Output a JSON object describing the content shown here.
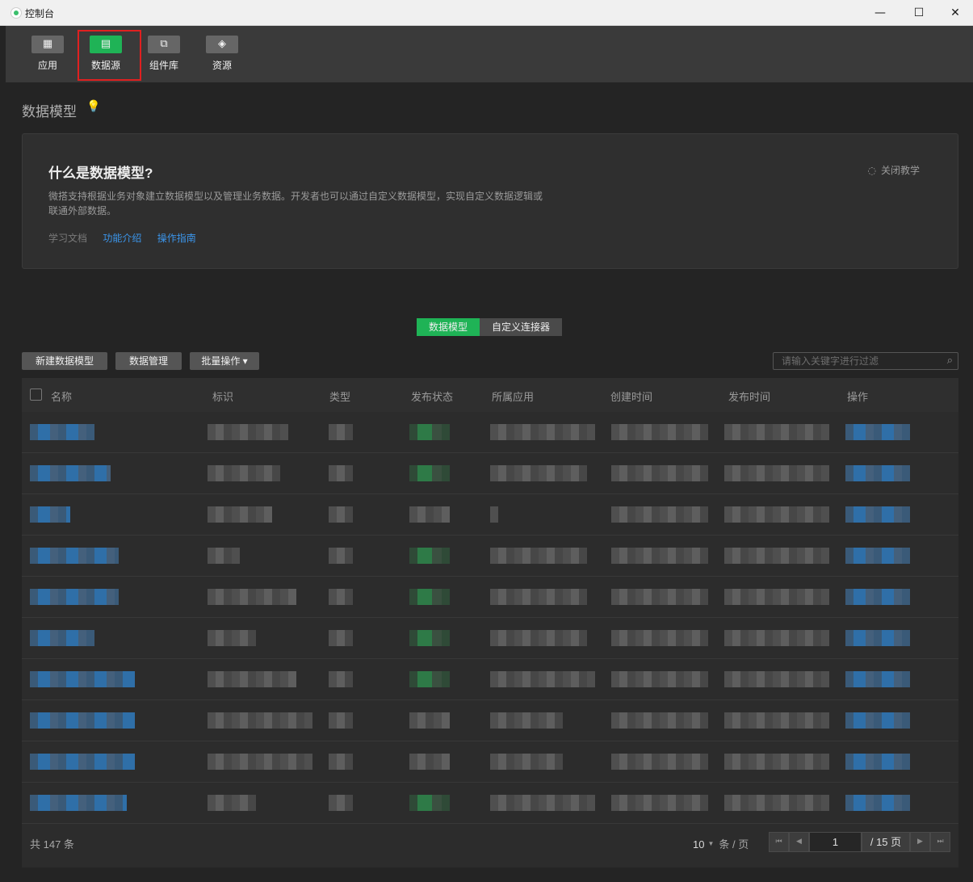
{
  "window": {
    "title": "控制台",
    "minimize": "—",
    "maximize": "☐",
    "close": "✕"
  },
  "toolbar": {
    "items": [
      {
        "label": "应用",
        "icon": "grid-icon",
        "glyph": "▦"
      },
      {
        "label": "数据源",
        "icon": "database-icon",
        "glyph": "▤"
      },
      {
        "label": "组件库",
        "icon": "components-icon",
        "glyph": "⧉"
      },
      {
        "label": "资源",
        "icon": "layers-icon",
        "glyph": "◈"
      }
    ],
    "active_index": 1
  },
  "page": {
    "title": "数据模型",
    "bulb_glyph": "💡"
  },
  "intro": {
    "heading": "什么是数据模型?",
    "description": "微搭支持根据业务对象建立数据模型以及管理业务数据。开发者也可以通过自定义数据模型，实现自定义数据逻辑或联通外部数据。",
    "docs_label": "学习文档",
    "link_features": "功能介绍",
    "link_guide": "操作指南",
    "close_label": "关闭教学",
    "eye_glyph": "◌"
  },
  "tabs": [
    {
      "label": "数据模型",
      "active": true
    },
    {
      "label": "自定义连接器",
      "active": false
    }
  ],
  "actions": {
    "new_model": "新建数据模型",
    "data_manage": "数据管理",
    "batch_ops": "批量操作 ▾",
    "search_placeholder": "请输入关键字进行过滤",
    "search_glyph": "⌕"
  },
  "table": {
    "columns": [
      "名称",
      "标识",
      "类型",
      "发布状态",
      "所属应用",
      "创建时间",
      "发布时间",
      "操作"
    ],
    "row_count_visible": 10
  },
  "footer": {
    "total_text": "共 147 条",
    "page_size": "10",
    "page_size_caret": "▼",
    "page_size_unit": "条 / 页",
    "current_page": "1",
    "total_pages": "/ 15 页",
    "first_glyph": "⏮",
    "prev_glyph": "◀",
    "next_glyph": "▶",
    "last_glyph": "⏭"
  },
  "colors": {
    "accent_green": "#1fb356",
    "link_blue": "#3b95ea",
    "highlight_red": "#e02020"
  }
}
